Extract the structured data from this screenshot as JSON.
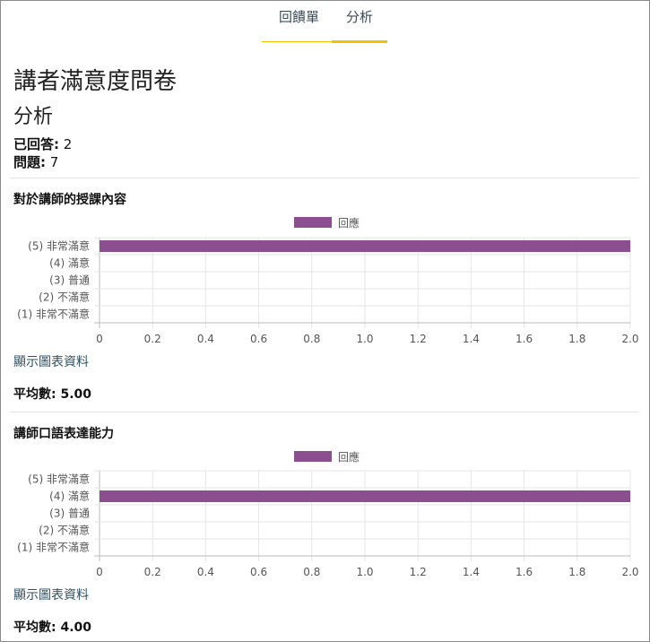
{
  "tabs": [
    {
      "label": "回饋單",
      "active": false
    },
    {
      "label": "分析",
      "active": true
    }
  ],
  "survey_title": "講者滿意度問卷",
  "section_title": "分析",
  "stats": {
    "answered_label": "已回答:",
    "answered_value": "2",
    "questions_label": "問題:",
    "questions_value": "7"
  },
  "questions": [
    {
      "title": "對於講師的授課內容",
      "legend": "回應",
      "show_data_label": "顯示圖表資料",
      "average_label": "平均數:",
      "average_value": "5.00"
    },
    {
      "title": "講師口語表達能力",
      "legend": "回應",
      "show_data_label": "顯示圖表資料",
      "average_label": "平均數:",
      "average_value": "4.00"
    }
  ],
  "colors": {
    "bar": "#8b4f8f",
    "accent": "#f2c300"
  },
  "chart_data": [
    {
      "type": "bar",
      "orientation": "horizontal",
      "categories": [
        "(5) 非常滿意",
        "(4) 滿意",
        "(3) 普通",
        "(2) 不滿意",
        "(1) 非常不滿意"
      ],
      "series": [
        {
          "name": "回應",
          "values": [
            2,
            0,
            0,
            0,
            0
          ]
        }
      ],
      "xlim": [
        0,
        2.0
      ],
      "xticks": [
        "0",
        "0.2",
        "0.4",
        "0.6",
        "0.8",
        "1.0",
        "1.2",
        "1.4",
        "1.6",
        "1.8",
        "2.0"
      ],
      "grid": true,
      "legend_position": "top-center"
    },
    {
      "type": "bar",
      "orientation": "horizontal",
      "categories": [
        "(5) 非常滿意",
        "(4) 滿意",
        "(3) 普通",
        "(2) 不滿意",
        "(1) 非常不滿意"
      ],
      "series": [
        {
          "name": "回應",
          "values": [
            0,
            2,
            0,
            0,
            0
          ]
        }
      ],
      "xlim": [
        0,
        2.0
      ],
      "xticks": [
        "0",
        "0.2",
        "0.4",
        "0.6",
        "0.8",
        "1.0",
        "1.2",
        "1.4",
        "1.6",
        "1.8",
        "2.0"
      ],
      "grid": true,
      "legend_position": "top-center"
    }
  ]
}
